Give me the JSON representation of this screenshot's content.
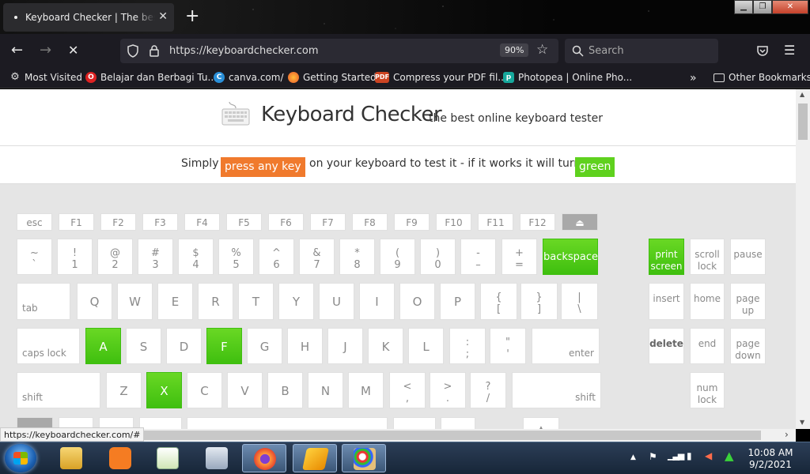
{
  "browser": {
    "tab_title": "Keyboard Checker | The best online keyboard tester",
    "tab_close": "✕",
    "new_tab": "+",
    "url": "https://keyboardchecker.com",
    "zoom": "90%",
    "search_placeholder": "Search",
    "status_url": "https://keyboardchecker.com/#"
  },
  "bookmarks": [
    {
      "label": "Most Visited",
      "icon": "gear-icon"
    },
    {
      "label": "Belajar dan Berbagi Tu...",
      "icon": "site-icon"
    },
    {
      "label": "canva.com/",
      "icon": "canva-icon"
    },
    {
      "label": "Getting Started",
      "icon": "firefox-icon"
    },
    {
      "label": "Compress your PDF fil...",
      "icon": "pdf-icon"
    },
    {
      "label": "Photopea | Online Pho...",
      "icon": "photopea-icon"
    }
  ],
  "other_bookmarks": "Other Bookmarks",
  "site": {
    "title": "Keyboard Checker",
    "tagline": "the best online keyboard tester",
    "instr_1": "Simply",
    "instr_press": "press any key",
    "instr_2": "on your keyboard to test it - if it works it will turn",
    "instr_green": "green"
  },
  "colors": {
    "pressed": "#4cc716",
    "orange": "#f07a2d"
  },
  "keys": {
    "fn_row": [
      "esc",
      "F1",
      "F2",
      "F3",
      "F4",
      "F5",
      "F6",
      "F7",
      "F8",
      "F9",
      "F10",
      "F11",
      "F12",
      "⏏"
    ],
    "num_row": [
      [
        "~",
        "`"
      ],
      [
        "!",
        "1"
      ],
      [
        "@",
        "2"
      ],
      [
        "#",
        "3"
      ],
      [
        "$",
        "4"
      ],
      [
        "%",
        "5"
      ],
      [
        "^",
        "6"
      ],
      [
        "&",
        "7"
      ],
      [
        "*",
        "8"
      ],
      [
        "(",
        "9"
      ],
      [
        ")",
        "0"
      ],
      [
        "-",
        "–"
      ],
      [
        "+",
        "="
      ]
    ],
    "backspace": "backspace",
    "tab": "tab",
    "qwerty": [
      "Q",
      "W",
      "E",
      "R",
      "T",
      "Y",
      "U",
      "I",
      "O",
      "P"
    ],
    "brackets": [
      [
        "{",
        "["
      ],
      [
        "}",
        "]"
      ],
      [
        "|",
        "\\"
      ]
    ],
    "caps": "caps lock",
    "asdf": [
      "A",
      "S",
      "D",
      "F",
      "G",
      "H",
      "J",
      "K",
      "L"
    ],
    "semi": [
      [
        ":",
        ";"
      ],
      [
        "\"",
        "'"
      ]
    ],
    "enter": "enter",
    "shift": "shift",
    "zxcv": [
      "Z",
      "X",
      "C",
      "V",
      "B",
      "N",
      "M"
    ],
    "punct": [
      [
        "<",
        ","
      ],
      [
        ">",
        "."
      ],
      [
        "?",
        "/"
      ]
    ],
    "shift_r": "shift",
    "nav": {
      "print": [
        "print",
        "screen"
      ],
      "scroll": [
        "scroll",
        "lock"
      ],
      "pause": "pause",
      "insert": "insert",
      "home": "home",
      "pageup": [
        "page",
        "up"
      ],
      "delete": "delete",
      "end": "end",
      "pagedown": [
        "page",
        "down"
      ],
      "numlock": [
        "num",
        "lock"
      ],
      "up": "▲"
    },
    "pressed": [
      "A",
      "F",
      "X",
      "backspace",
      "print"
    ]
  },
  "taskbar": {
    "time": "10:08 AM",
    "date": "9/2/2021"
  }
}
